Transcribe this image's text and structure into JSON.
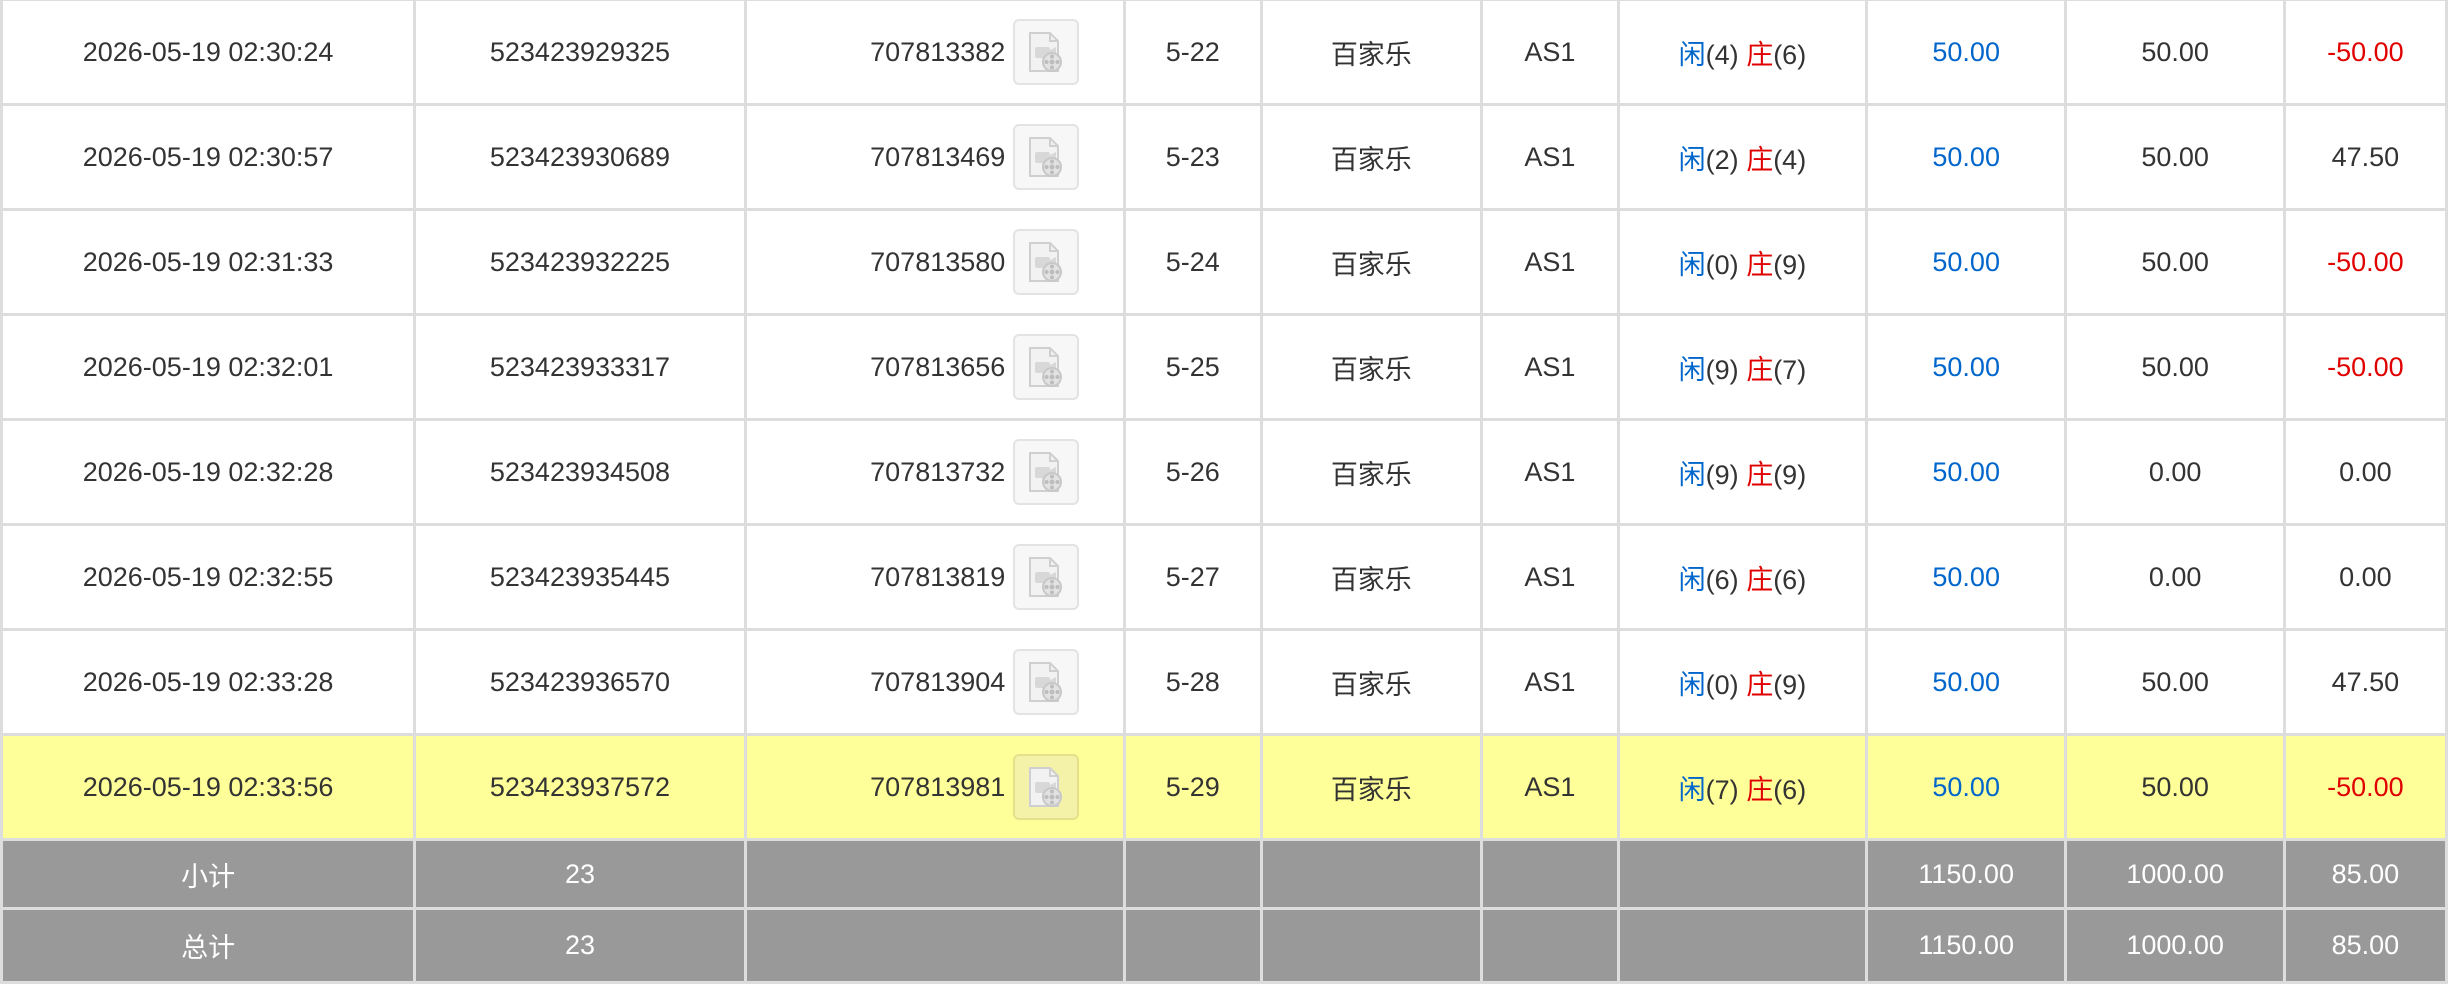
{
  "rows": [
    {
      "time": "2026-05-19 02:30:24",
      "order_id": "523423929325",
      "game_id": "707813382",
      "round": "5-22",
      "game": "百家乐",
      "table": "AS1",
      "player_label": "闲",
      "player_pts": "(4)",
      "banker_label": "庄",
      "banker_pts": "(6)",
      "bet": "50.00",
      "valid": "50.00",
      "result": "-50.00",
      "negative": true
    },
    {
      "time": "2026-05-19 02:30:57",
      "order_id": "523423930689",
      "game_id": "707813469",
      "round": "5-23",
      "game": "百家乐",
      "table": "AS1",
      "player_label": "闲",
      "player_pts": "(2)",
      "banker_label": "庄",
      "banker_pts": "(4)",
      "bet": "50.00",
      "valid": "50.00",
      "result": "47.50",
      "negative": false
    },
    {
      "time": "2026-05-19 02:31:33",
      "order_id": "523423932225",
      "game_id": "707813580",
      "round": "5-24",
      "game": "百家乐",
      "table": "AS1",
      "player_label": "闲",
      "player_pts": "(0)",
      "banker_label": "庄",
      "banker_pts": "(9)",
      "bet": "50.00",
      "valid": "50.00",
      "result": "-50.00",
      "negative": true
    },
    {
      "time": "2026-05-19 02:32:01",
      "order_id": "523423933317",
      "game_id": "707813656",
      "round": "5-25",
      "game": "百家乐",
      "table": "AS1",
      "player_label": "闲",
      "player_pts": "(9)",
      "banker_label": "庄",
      "banker_pts": "(7)",
      "bet": "50.00",
      "valid": "50.00",
      "result": "-50.00",
      "negative": true
    },
    {
      "time": "2026-05-19 02:32:28",
      "order_id": "523423934508",
      "game_id": "707813732",
      "round": "5-26",
      "game": "百家乐",
      "table": "AS1",
      "player_label": "闲",
      "player_pts": "(9)",
      "banker_label": "庄",
      "banker_pts": "(9)",
      "bet": "50.00",
      "valid": "0.00",
      "result": "0.00",
      "negative": false
    },
    {
      "time": "2026-05-19 02:32:55",
      "order_id": "523423935445",
      "game_id": "707813819",
      "round": "5-27",
      "game": "百家乐",
      "table": "AS1",
      "player_label": "闲",
      "player_pts": "(6)",
      "banker_label": "庄",
      "banker_pts": "(6)",
      "bet": "50.00",
      "valid": "0.00",
      "result": "0.00",
      "negative": false
    },
    {
      "time": "2026-05-19 02:33:28",
      "order_id": "523423936570",
      "game_id": "707813904",
      "round": "5-28",
      "game": "百家乐",
      "table": "AS1",
      "player_label": "闲",
      "player_pts": "(0)",
      "banker_label": "庄",
      "banker_pts": "(9)",
      "bet": "50.00",
      "valid": "50.00",
      "result": "47.50",
      "negative": false
    },
    {
      "time": "2026-05-19 02:33:56",
      "order_id": "523423937572",
      "game_id": "707813981",
      "round": "5-29",
      "game": "百家乐",
      "table": "AS1",
      "player_label": "闲",
      "player_pts": "(7)",
      "banker_label": "庄",
      "banker_pts": "(6)",
      "bet": "50.00",
      "valid": "50.00",
      "result": "-50.00",
      "negative": true,
      "highlighted": true
    }
  ],
  "subtotal": {
    "label": "小计",
    "count": "23",
    "bet": "1150.00",
    "valid": "1000.00",
    "result": "85.00"
  },
  "total": {
    "label": "总计",
    "count": "23",
    "bet": "1150.00",
    "valid": "1000.00",
    "result": "85.00"
  },
  "icons": {
    "replay": "video-replay-icon"
  },
  "colors": {
    "player": "#0066cc",
    "banker": "#e00000",
    "bet": "#0066cc",
    "negative": "#e00000",
    "highlight": "#ffff99",
    "summary_bg": "#999999"
  }
}
